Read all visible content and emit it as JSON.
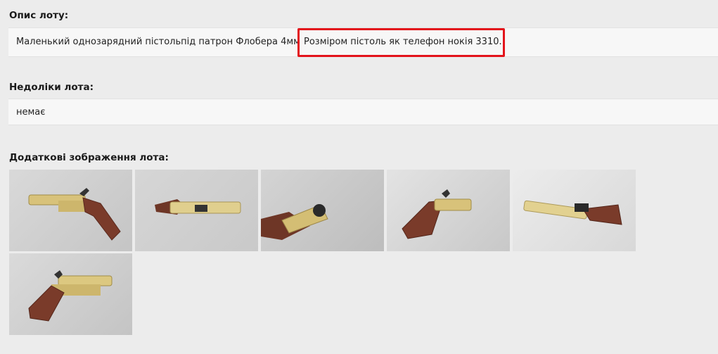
{
  "description": {
    "heading": "Опис лоту:",
    "text_before": "Маленький однозарядний пістольпід патрон Флобера 4мм",
    "text_highlight": "Розміром пістоль як телефон нокія 3310."
  },
  "defects": {
    "heading": "Недоліки лота:",
    "text": "немає"
  },
  "gallery": {
    "heading": "Додаткові зображення лота:",
    "images": [
      "pistol-photo-side-left",
      "pistol-photo-top-barrel",
      "pistol-photo-muzzle-end",
      "pistol-photo-side-right-grip",
      "pistol-photo-angled-barrel",
      "pistol-photo-side-left-2"
    ]
  },
  "colors": {
    "highlight": "#e3141b",
    "brass": "#d8c27a",
    "grip": "#7a3b2a"
  }
}
